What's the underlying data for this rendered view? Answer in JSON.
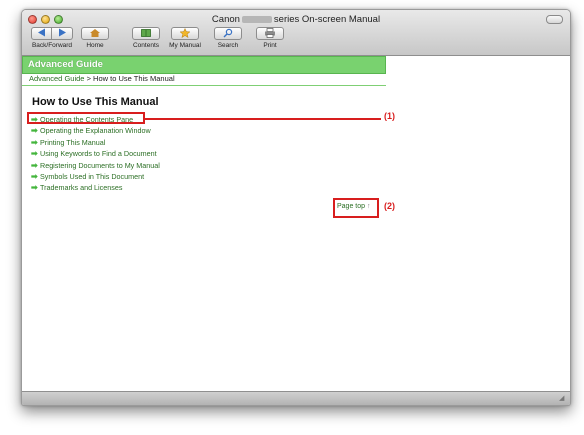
{
  "window": {
    "title_left": "Canon",
    "title_right": "series On-screen Manual"
  },
  "toolbar": {
    "back_forward_label": "Back/Forward",
    "home_label": "Home",
    "contents_label": "Contents",
    "my_manual_label": "My Manual",
    "search_label": "Search",
    "print_label": "Print"
  },
  "banner": {
    "title": "Advanced Guide"
  },
  "breadcrumb": {
    "root": "Advanced Guide",
    "separator": ">",
    "current": "How to Use This Manual"
  },
  "page": {
    "heading": "How to Use This Manual",
    "links": [
      "Operating the Contents Pane",
      "Operating the Explanation Window",
      "Printing This Manual",
      "Using Keywords to Find a Document",
      "Registering Documents to My Manual",
      "Symbols Used in This Document",
      "Trademarks and Licenses"
    ],
    "page_top": "Page top"
  },
  "callouts": {
    "one": "(1)",
    "two": "(2)"
  },
  "colors": {
    "banner": "#79d26f",
    "link": "#2c6f25",
    "arrow": "#43b53c",
    "callout": "#d81e1e"
  }
}
